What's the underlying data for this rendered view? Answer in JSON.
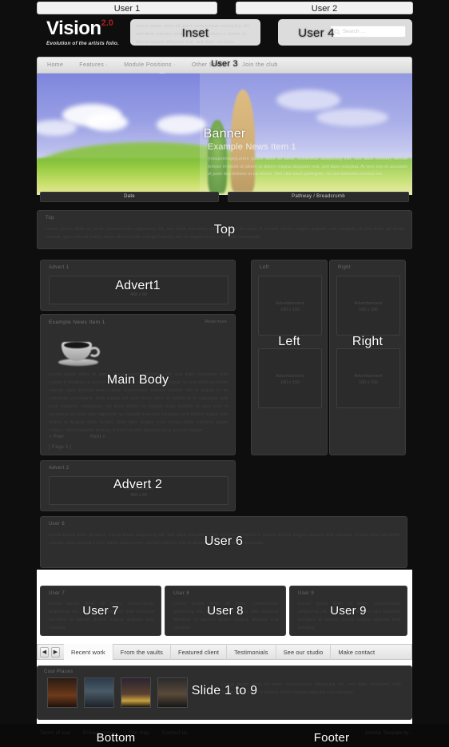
{
  "page": {
    "background": "#0d0d0d",
    "accent": "#b02020"
  },
  "header": {
    "logo_text": "Vision",
    "logo_sup": "2.0",
    "tagline": "Evolution of the artists folio.",
    "inset_ghost": "Lorem ipsum dolor sit amet, consectetur adipiscing elit, sed diam nonumy eirmod tempor invidunt ut labore et dolore magna aliquyam erat, sed diam voluptua.",
    "search_placeholder": "Search ...",
    "search_icon": "magnifier-icon"
  },
  "position_labels": {
    "user1": "User 1",
    "user2": "User 2",
    "user3": "User 3",
    "user4": "User 4",
    "inset": "Inset",
    "banner": "Banner",
    "top": "Top",
    "advert1": "Advert1",
    "advert2": "Advert 2",
    "main_body": "Main Body",
    "left": "Left",
    "right": "Right",
    "user6": "User 6",
    "user7": "User 7",
    "user8": "User 8",
    "user9": "User 9",
    "slide": "Slide 1 to 9",
    "bottom": "Bottom",
    "footer": "Footer"
  },
  "nav": {
    "items": [
      {
        "label": "Home"
      },
      {
        "label": "Features ·"
      },
      {
        "label": "Module Positions ·"
      },
      {
        "label": "Other Stuff ·"
      },
      {
        "label": "Join the club"
      }
    ]
  },
  "banner": {
    "news_title": "Example News Item 1",
    "news_body": "(mouseimage)Lorem ipsum dolor sit amet, consetetur sadipscing elitr, sed diam nonumy eirmod tempor invidunt ut labore et dolore magna aliquyam erat, sed diam voluptua. At vero eos et accusam et justo duo dolores et ea rebum. Stet clita kasd gubergren, no sea takimata sanctus est."
  },
  "bars": {
    "date_label": "Date",
    "pathway_label": "Pathway / Breadcrumb"
  },
  "modules": {
    "top": {
      "title": "Top",
      "body": "Lorem ipsum dolor sit amet, consectetuer adipiscing elit, sed diam nonummy nibh euismod tincidunt ut laoreet dolore magna aliquam erat volutpat. Ut wisi enim ad minim veniam, quis nostrud exerci tation ullamcorper suscipit lobortis nisl ut aliquip ex ea commodo consequat."
    },
    "advert1": {
      "title": "Advert 1",
      "ad_line1": "Advertisement",
      "ad_line2": "468 x 60"
    },
    "advert2": {
      "title": "Advert 2",
      "ad_line1": "Advertisement",
      "ad_line2": "468 x 60"
    },
    "left": {
      "title": "Left",
      "ad_line1": "Advertisement",
      "ad_line2": "180 x 150"
    },
    "right": {
      "title": "Right",
      "ad_line1": "Advertisement",
      "ad_line2": "180 x 150"
    },
    "user6": {
      "title": "User 6",
      "body": "Lorem ipsum dolor sit amet, consectetuer adipiscing elit, sed diam nonummy nibh euismod tincidunt ut laoreet dolore magna aliquam erat volutpat. Ut wisi enim ad minim veniam, quis nostrud exerci tation ullamcorper suscipit lobortis nisl ut aliquip ex ea commodo consequat."
    },
    "user7": {
      "title": "User 7",
      "body": "Lorem ipsum dolor sit amet, consectetuer adipiscing elit, sed diam nonummy nibh euismod tincidunt ut laoreet dolore magna aliquam erat volutpat."
    },
    "user8": {
      "title": "User 8",
      "body": "Lorem ipsum dolor sit amet, consectetuer adipiscing elit, sed diam nonummy nibh euismod tincidunt ut laoreet dolore magna aliquam erat volutpat."
    },
    "user9": {
      "title": "User 9",
      "body": "Lorem ipsum dolor sit amet, consectetuer adipiscing elit, sed diam nonummy nibh euismod tincidunt ut laoreet dolore magna aliquam erat volutpat."
    },
    "slide": {
      "title": "Cool Places",
      "body": "Lorem ipsum dolor sit amet, consectetuer adipiscing elit, sed diam nonummy nibh euismod tincidunt ut laoreet dolore magna aliquam erat volutpat."
    }
  },
  "main_article": {
    "title": "Example News Item 1",
    "read_more": "Read more",
    "image_alt": "coffee-cup-image",
    "body": "Lorem ipsum dolor sit amet, consectetuer adipiscing elit, sed diam nonummy nibh euismod tincidunt ut laoreet dolore magna aliquam erat volutpat. Ut wisi enim ad minim veniam, quis nostrud exerci tation ullamcorper suscipit lobortis nisl ut aliquip ex ea commodo consequat. Duis autem vel eum iriure dolor in hendrerit in vulputate velit esse molestie consequat, vel illum dolore eu feugiat nulla facilisis at vero eros et accumsan et iusto odio dignissim qui blandit praesent luptatum zzril delenit augue duis dolore te feugait nulla facilisi. Nam liber tempor cum soluta nobis eleifend option congue nihil imperdiet doming id quod mazim placerat facer possim assum.",
    "prev_label": "« Prev",
    "next_label": "Next »",
    "page_indicator": "[ Page 1 ]"
  },
  "tabs": {
    "prev_icon": "chevron-left-icon",
    "next_icon": "chevron-right-icon",
    "items": [
      {
        "label": "Recent work",
        "active": true
      },
      {
        "label": "From the vaults",
        "active": false
      },
      {
        "label": "Featured client",
        "active": false
      },
      {
        "label": "Testimonials",
        "active": false
      },
      {
        "label": "See our studio",
        "active": false
      },
      {
        "label": "Make contact",
        "active": false
      }
    ]
  },
  "footer": {
    "links": [
      "Terms of use",
      "Privacy policy",
      "Site map",
      "Contact us"
    ],
    "credit": "Joomla! Template by..."
  }
}
